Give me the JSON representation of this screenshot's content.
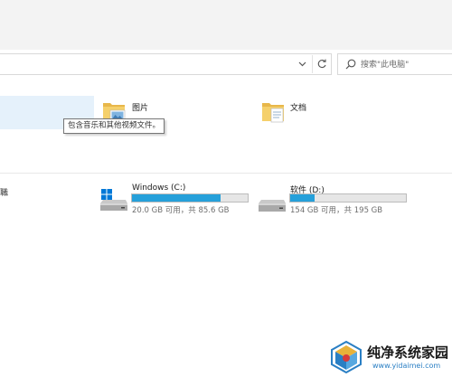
{
  "search": {
    "placeholder": "搜索\"此电脑\""
  },
  "folders": [
    {
      "label": "图片",
      "icon": "pictures-folder-icon"
    },
    {
      "label": "文档",
      "icon": "documents-folder-icon"
    }
  ],
  "tooltip": "包含音乐和其他视频文件。",
  "section_tail": "職",
  "drives": [
    {
      "name": "Windows (C:)",
      "space": "20.0 GB 可用，共 85.6 GB",
      "used_fraction": 0.766,
      "icon": "windows-drive-icon"
    },
    {
      "name": "软件 (D:)",
      "space": "154 GB 可用，共 195 GB",
      "used_fraction": 0.21,
      "icon": "hard-drive-icon"
    }
  ],
  "colors": {
    "bar_fill": "#26a0da",
    "selection": "#e5f1fb",
    "accent": "#0078d7"
  },
  "watermark": {
    "text": "纯净系统家园",
    "url": "www.yidaimei.com"
  }
}
